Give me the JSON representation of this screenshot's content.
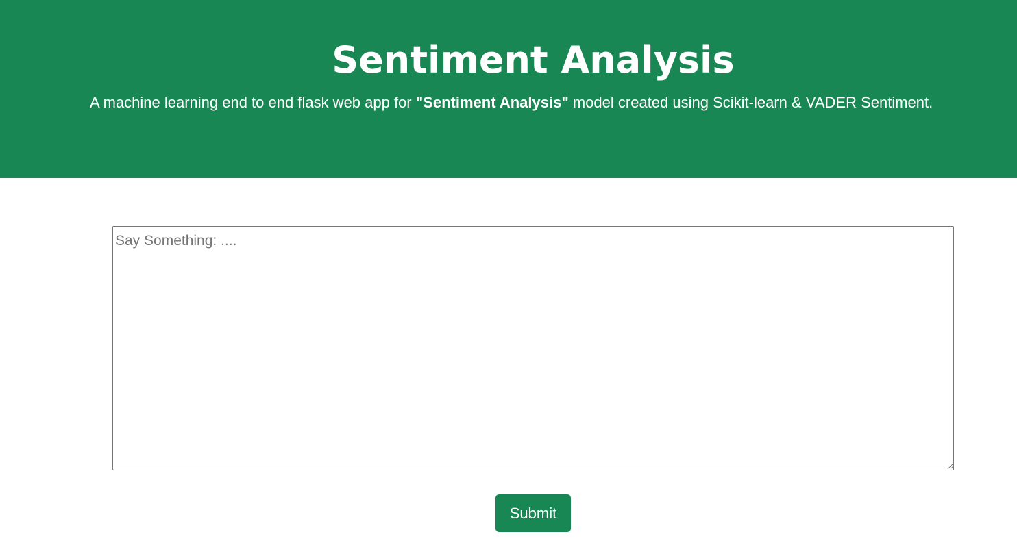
{
  "header": {
    "title": "Sentiment Analysis",
    "subtitle_before": "A machine learning end to end flask web app for ",
    "subtitle_bold": "\"Sentiment Analysis\"",
    "subtitle_after": " model created using Scikit-learn & VADER Sentiment."
  },
  "form": {
    "input_value": "",
    "input_placeholder": "Say Something: ....",
    "submit_label": "Submit"
  },
  "colors": {
    "brand_green": "#198754",
    "background": "#ffffff",
    "text_on_brand": "#ffffff"
  }
}
